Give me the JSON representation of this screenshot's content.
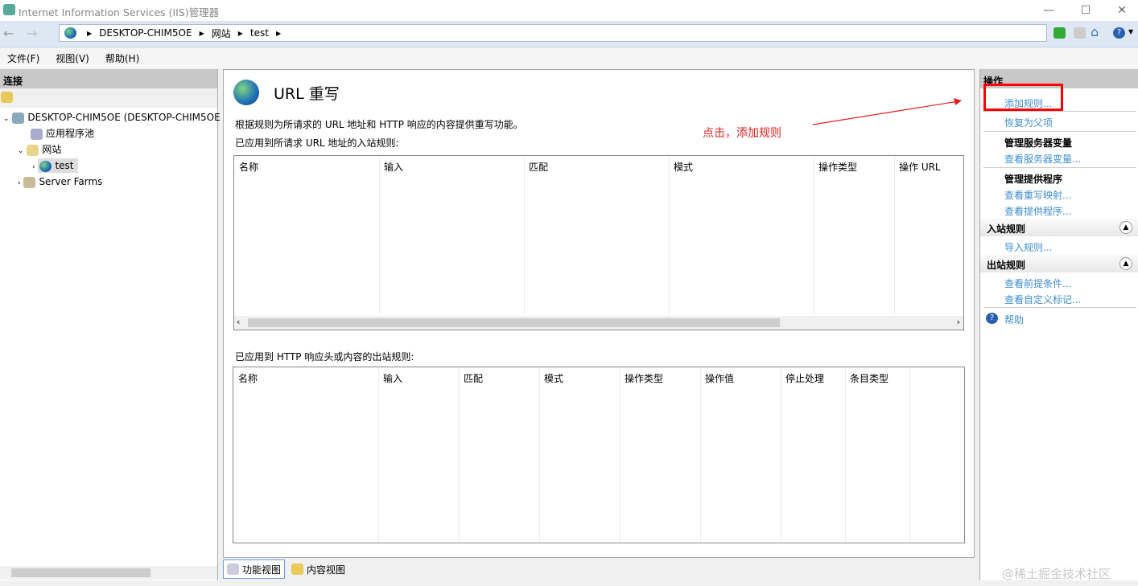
{
  "window": {
    "title": "Internet Information Services (IIS)管理器"
  },
  "address": {
    "crumbs": [
      "DESKTOP-CHIM5OE",
      "网站",
      "test"
    ]
  },
  "menu": [
    "文件(F)",
    "视图(V)",
    "帮助(H)"
  ],
  "connections": {
    "header": "连接",
    "tree": [
      {
        "label": "DESKTOP-CHIM5OE (DESKTOP-CHIM5OE"
      },
      {
        "label": "应用程序池"
      },
      {
        "label": "网站"
      },
      {
        "label": "test"
      },
      {
        "label": "Server Farms"
      }
    ]
  },
  "main": {
    "title": "URL 重写",
    "description": "根据规则为所请求的 URL 地址和 HTTP 响应的内容提供重写功能。",
    "inbound_label": "已应用到所请求 URL 地址的入站规则:",
    "inbound_columns": [
      "名称",
      "输入",
      "匹配",
      "模式",
      "操作类型",
      "操作 URL"
    ],
    "outbound_label": "已应用到 HTTP 响应头或内容的出站规则:",
    "outbound_columns": [
      "名称",
      "输入",
      "匹配",
      "模式",
      "操作类型",
      "操作值",
      "停止处理",
      "条目类型"
    ]
  },
  "bottom_tabs": [
    "功能视图",
    "内容视图"
  ],
  "actions": {
    "header": "操作",
    "add_rule": "添加规则...",
    "revert": "恢复为父项",
    "server_vars_title": "管理服务器变量",
    "view_server_vars": "查看服务器变量...",
    "providers_title": "管理提供程序",
    "view_rewrite_maps": "查看重写映射...",
    "view_providers": "查看提供程序...",
    "inbound_title": "入站规则",
    "import_rules": "导入规则...",
    "outbound_title": "出站规则",
    "view_preconditions": "查看前提条件...",
    "view_custom_tags": "查看自定义标记...",
    "help": "帮助"
  },
  "annotation": {
    "text": "点击，添加规则",
    "color": "#e02020"
  },
  "watermark": "@稀土掘金技术社区"
}
